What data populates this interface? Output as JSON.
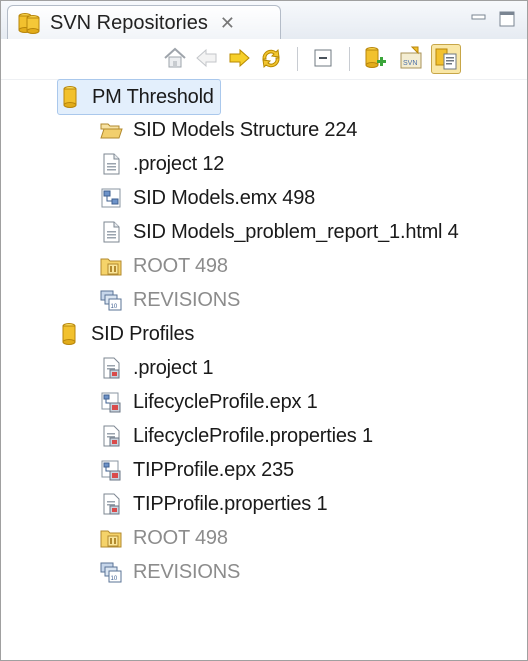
{
  "view": {
    "title": "SVN Repositories",
    "close_glyph": "✕"
  },
  "toolbar": {
    "buttons": [
      {
        "name": "home-icon"
      },
      {
        "name": "back-icon",
        "disabled": true
      },
      {
        "name": "forward-icon"
      },
      {
        "name": "refresh-icon"
      },
      {
        "name": "collapse-all-icon"
      },
      {
        "name": "new-repository-icon"
      },
      {
        "name": "svn-import-icon"
      },
      {
        "name": "link-with-editor-icon",
        "selected": true
      }
    ]
  },
  "tree": [
    {
      "label": "PM Threshold",
      "icon": "repository-icon",
      "level": 0,
      "selected": true
    },
    {
      "label": "SID Models Structure 224",
      "icon": "folder-open-icon",
      "level": 1
    },
    {
      "label": ".project 12",
      "icon": "file-icon",
      "level": 1
    },
    {
      "label": "SID Models.emx 498",
      "icon": "model-file-icon",
      "level": 1
    },
    {
      "label": "SID Models_problem_report_1.html 4",
      "icon": "file-icon",
      "level": 1
    },
    {
      "label": "ROOT 498",
      "icon": "root-folder-icon",
      "level": 1,
      "gray": true
    },
    {
      "label": "REVISIONS",
      "icon": "revisions-icon",
      "level": 1,
      "gray": true
    },
    {
      "label": "SID Profiles",
      "icon": "repository-icon",
      "level": 0
    },
    {
      "label": ".project 1",
      "icon": "profile-file-icon",
      "level": 1
    },
    {
      "label": "LifecycleProfile.epx 1",
      "icon": "profile-model-icon",
      "level": 1
    },
    {
      "label": "LifecycleProfile.properties 1",
      "icon": "profile-file-icon",
      "level": 1
    },
    {
      "label": "TIPProfile.epx 235",
      "icon": "profile-model-icon",
      "level": 1
    },
    {
      "label": "TIPProfile.properties 1",
      "icon": "profile-file-icon",
      "level": 1
    },
    {
      "label": "ROOT 498",
      "icon": "root-folder-icon",
      "level": 1,
      "gray": true
    },
    {
      "label": "REVISIONS",
      "icon": "revisions-icon",
      "level": 1,
      "gray": true
    }
  ]
}
